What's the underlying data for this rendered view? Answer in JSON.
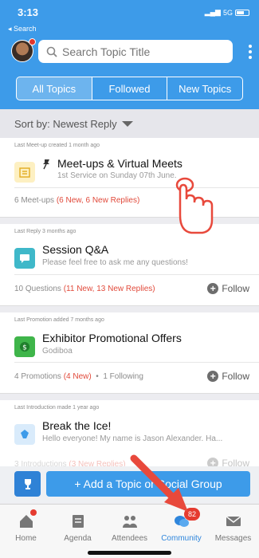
{
  "status_bar": {
    "time": "3:13",
    "back_label": "◂ Search",
    "network": "5G"
  },
  "search": {
    "placeholder": "Search Topic Title"
  },
  "segments": [
    {
      "label": "All Topics",
      "active": true
    },
    {
      "label": "Followed",
      "active": false
    },
    {
      "label": "New Topics",
      "active": false
    }
  ],
  "sort": {
    "label": "Sort by: Newest Reply"
  },
  "cards": [
    {
      "meta": "Last Meet-up created 1 month ago",
      "title": "Meet-ups & Virtual Meets",
      "subtitle": "1st Service on Sunday 07th June.",
      "footer_count": "6 Meet-ups",
      "footer_new": "(6 New, 6 New Replies)",
      "icon": "calendar-icon",
      "icon_color": "#f4c84a",
      "pinned": true,
      "follow": false
    },
    {
      "meta": "Last Reply 3 months ago",
      "title": "Session Q&A",
      "subtitle": "Please feel free to ask me any questions!",
      "footer_count": "10 Questions",
      "footer_new": "(11 New, 13 New Replies)",
      "icon": "chat-icon",
      "icon_color": "#3fb8c9",
      "follow": true,
      "follow_label": "Follow"
    },
    {
      "meta": "Last Promotion added 7 months ago",
      "title": "Exhibitor Promotional Offers",
      "subtitle": "Godiboa",
      "footer_count": "4 Promotions",
      "footer_new": "(4 New)",
      "footer_extra": "1 Following",
      "icon": "dollar-icon",
      "icon_color": "#3fb54a",
      "follow": true,
      "follow_label": "Follow"
    },
    {
      "meta": "Last Introduction made 1 year ago",
      "title": "Break the Ice!",
      "subtitle": "Hello everyone! My name is Jason Alexander. Ha...",
      "footer_count": "3 Introductions",
      "footer_new": "(3 New Replies)",
      "icon": "ice-icon",
      "icon_color": "#3d9be9",
      "follow": true,
      "follow_label": "Follow"
    }
  ],
  "action": {
    "add_label": "+ Add a Topic or Social Group"
  },
  "tabs": [
    {
      "label": "Home",
      "icon": "home-icon",
      "active": false
    },
    {
      "label": "Agenda",
      "icon": "agenda-icon",
      "active": false
    },
    {
      "label": "Attendees",
      "icon": "attendees-icon",
      "active": false
    },
    {
      "label": "Community",
      "icon": "community-icon",
      "active": true,
      "badge": "82"
    },
    {
      "label": "Messages",
      "icon": "messages-icon",
      "active": false
    }
  ],
  "colors": {
    "brand": "#3d9be9",
    "alert": "#e53b30"
  }
}
